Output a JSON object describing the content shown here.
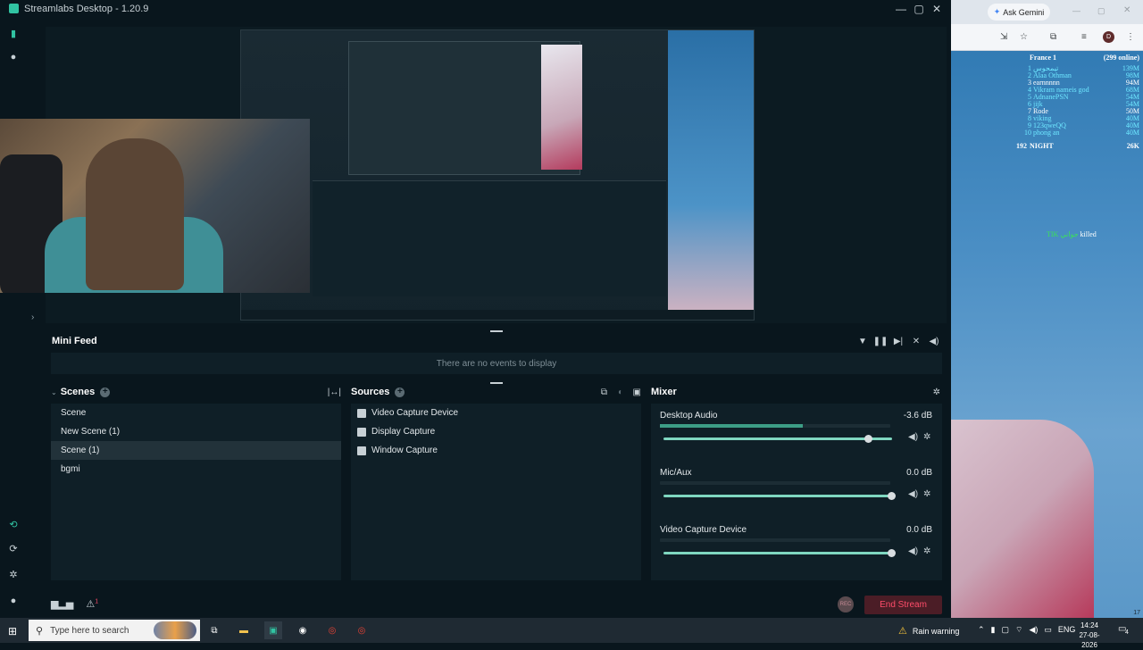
{
  "window": {
    "title": "Streamlabs Desktop - 1.20.9",
    "controls": [
      "minimize-icon",
      "maximize-icon",
      "close-icon"
    ]
  },
  "minifeed": {
    "title": "Mini Feed",
    "empty_text": "There are no events to display"
  },
  "scenes": {
    "title": "Scenes",
    "items": [
      {
        "label": "Scene",
        "active": false
      },
      {
        "label": "New Scene (1)",
        "active": false
      },
      {
        "label": "Scene (1)",
        "active": true
      },
      {
        "label": "bgmi",
        "active": false
      }
    ]
  },
  "sources": {
    "title": "Sources",
    "items": [
      {
        "label": "Video Capture Device",
        "icon": "webcam-icon"
      },
      {
        "label": "Display Capture",
        "icon": "monitor-icon"
      },
      {
        "label": "Window Capture",
        "icon": "window-icon"
      }
    ]
  },
  "mixer": {
    "title": "Mixer",
    "channels": [
      {
        "name": "Desktop Audio",
        "db": "-3.6 dB",
        "meter_level": 0.62,
        "volume": 0.9
      },
      {
        "name": "Mic/Aux",
        "db": "0.0 dB",
        "meter_level": 0.0,
        "volume": 1.0
      },
      {
        "name": "Video Capture Device",
        "db": "0.0 dB",
        "meter_level": 0.0,
        "volume": 1.0
      }
    ]
  },
  "footer": {
    "alerts_badge": "1",
    "rec_label": "REC",
    "end_stream": "End Stream"
  },
  "browser": {
    "ask_gemini": "Ask Gemini",
    "avatar_letter": "D",
    "leaderboard": {
      "title": "France 1",
      "online": "(299 online)",
      "rows": [
        {
          "rank": "1",
          "name": "تیمحوس",
          "score": "139M",
          "color": "#6ee7ff"
        },
        {
          "rank": "2",
          "name": "Alaa Othman",
          "score": "98M",
          "color": "#6ee7ff"
        },
        {
          "rank": "3",
          "name": "earnnnnn",
          "score": "94M",
          "color": "#ffffff"
        },
        {
          "rank": "4",
          "name": "Vikram nameis god",
          "score": "68M",
          "color": "#6ee7ff"
        },
        {
          "rank": "5",
          "name": "AdnanePSN",
          "score": "54M",
          "color": "#6ee7ff"
        },
        {
          "rank": "6",
          "name": "jijk",
          "score": "54M",
          "color": "#6ee7ff"
        },
        {
          "rank": "7",
          "name": "Rode",
          "score": "50M",
          "color": "#ffffff"
        },
        {
          "rank": "8",
          "name": "viking",
          "score": "40M",
          "color": "#6ee7ff"
        },
        {
          "rank": "9",
          "name": "123qweQQ",
          "score": "40M",
          "color": "#6ee7ff"
        },
        {
          "rank": "10",
          "name": "phong an",
          "score": "40M",
          "color": "#6ee7ff"
        }
      ],
      "self": {
        "rank": "192",
        "name": "NIGHT",
        "score": "26K"
      }
    },
    "killfeed": {
      "killer": "TIK جواني",
      "action": "killed"
    },
    "corner_text": "17"
  },
  "taskbar": {
    "search_placeholder": "Type here to search",
    "weather": "Rain warning",
    "lang": "ENG",
    "time": "14:24",
    "date": "27-08-2026",
    "notif_count": "4"
  },
  "colors": {
    "accent": "#31c3a2",
    "end_stream_text": "#ff4d6a",
    "panel_bg": "#0f1f27"
  }
}
